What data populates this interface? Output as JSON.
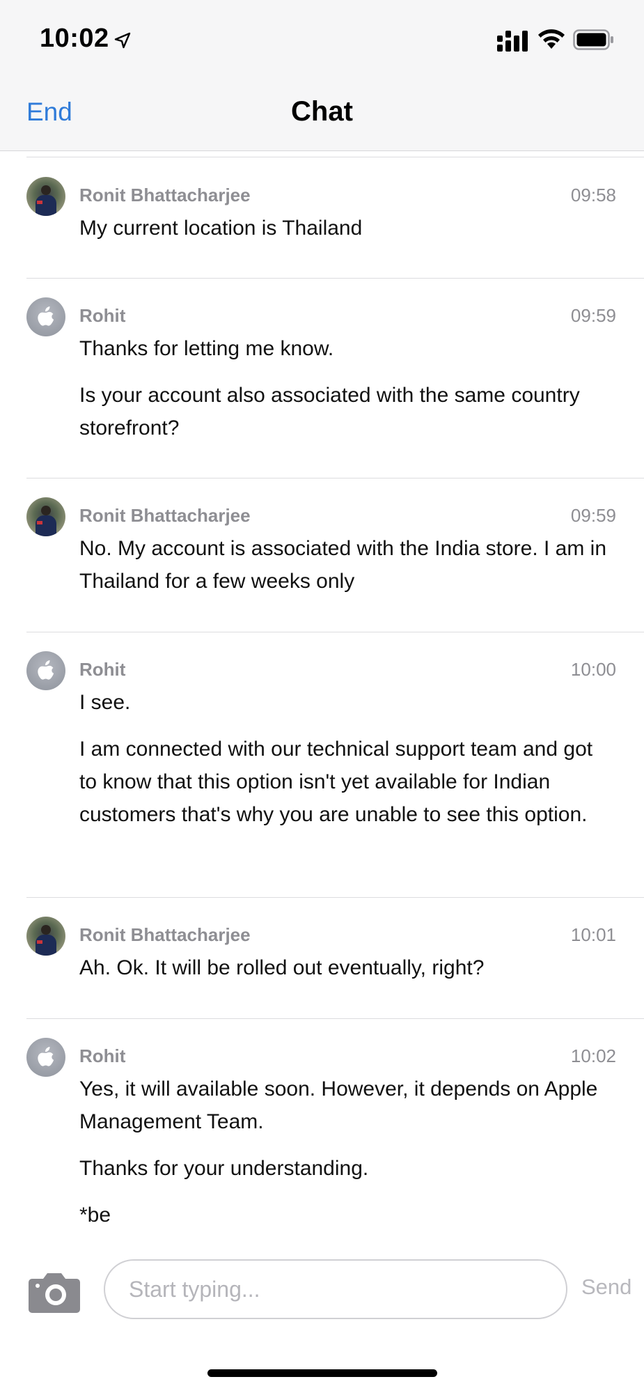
{
  "status_bar": {
    "time": "10:02",
    "location_icon": "location-arrow-icon",
    "signal_icon": "cellular-signal-icon",
    "wifi_icon": "wifi-icon",
    "battery_icon": "battery-icon"
  },
  "nav": {
    "end_label": "End",
    "title": "Chat"
  },
  "messages": [
    {
      "sender": "Ronit Bhattacharjee",
      "time": "09:58",
      "avatar": "user-avatar",
      "paragraphs": [
        "My current location is Thailand"
      ]
    },
    {
      "sender": "Rohit",
      "time": "09:59",
      "avatar": "apple-logo-avatar",
      "paragraphs": [
        "Thanks for letting me know.",
        "Is your account also associated with the same country storefront?"
      ]
    },
    {
      "sender": "Ronit Bhattacharjee",
      "time": "09:59",
      "avatar": "user-avatar",
      "paragraphs": [
        "No. My account is associated with the India store. I am in Thailand for a few weeks only"
      ]
    },
    {
      "sender": "Rohit",
      "time": "10:00",
      "avatar": "apple-logo-avatar",
      "paragraphs": [
        "I see.",
        "I am connected with our technical support team and got to know that this option isn't yet available for Indian customers that's why you are unable to see this option."
      ]
    },
    {
      "sender": "Ronit Bhattacharjee",
      "time": "10:01",
      "avatar": "user-avatar",
      "paragraphs": [
        "Ah. Ok. It will be rolled out eventually, right?"
      ]
    },
    {
      "sender": "Rohit",
      "time": "10:02",
      "avatar": "apple-logo-avatar",
      "paragraphs": [
        "Yes, it will available soon. However, it depends on Apple Management Team.",
        "Thanks for your understanding.",
        "*be"
      ]
    }
  ],
  "composer": {
    "camera_icon": "camera-icon",
    "placeholder": "Start typing...",
    "value": "",
    "send_label": "Send"
  },
  "colors": {
    "accent": "#2f7bd9",
    "secondary_text": "#8e8e93",
    "divider": "#dcdcdf",
    "send_disabled": "#b8b8bd"
  }
}
